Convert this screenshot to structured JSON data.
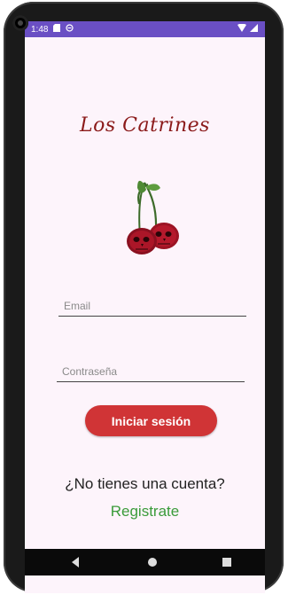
{
  "status_bar": {
    "time": "1:48",
    "left_icons": [
      "sd-card-icon",
      "no-disturb-icon"
    ],
    "right_icons": [
      "wifi-icon",
      "signal-icon"
    ]
  },
  "app": {
    "title": "Los Catrines",
    "logo": "cherry-skull-logo"
  },
  "form": {
    "email_placeholder": "Email",
    "email_value": "",
    "password_placeholder": "Contraseña",
    "password_value": "",
    "login_label": "Iniciar sesión"
  },
  "signup": {
    "prompt": "¿No tienes una cuenta?",
    "link_label": "Registrate"
  },
  "colors": {
    "status_bar": "#6a4fc4",
    "title": "#8b1a1a",
    "login_button": "#d03436",
    "register_link": "#3a9b3a",
    "background": "#fdf4fb"
  },
  "nav_bar": [
    "back-icon",
    "home-icon",
    "recents-icon"
  ]
}
